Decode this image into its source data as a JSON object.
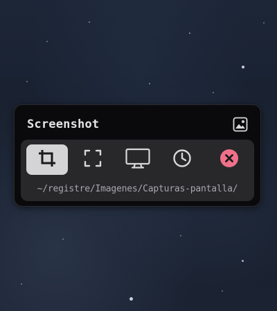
{
  "panel": {
    "title": "Screenshot",
    "gallery_icon": "image-gallery-icon",
    "path": "~/registre/Imagenes/Capturas-pantalla/"
  },
  "tools": [
    {
      "name": "crop-selection",
      "icon": "crop-icon",
      "active": true
    },
    {
      "name": "fullscreen-region",
      "icon": "fullscreen-icon",
      "active": false
    },
    {
      "name": "screen-capture",
      "icon": "monitor-icon",
      "active": false
    },
    {
      "name": "timer",
      "icon": "clock-icon",
      "active": false
    },
    {
      "name": "close",
      "icon": "close-icon",
      "active": false
    }
  ],
  "colors": {
    "panel_bg": "#0a0a0c",
    "inner_bg": "#28282b",
    "active_tool_bg": "#d4d4d6",
    "icon_color": "#d8d8da",
    "close_accent": "#f0708a",
    "text_primary": "#e4e4e6",
    "text_secondary": "#a8a8ac"
  }
}
